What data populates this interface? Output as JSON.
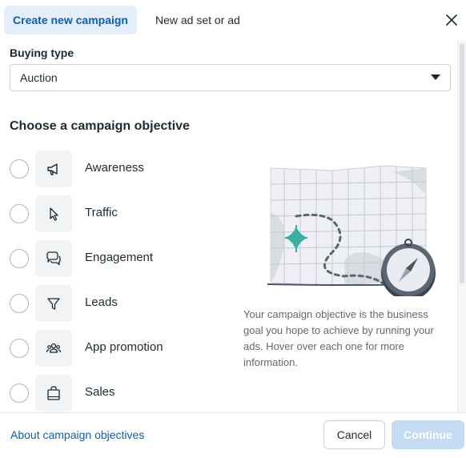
{
  "tabs": {
    "create_campaign": "Create new campaign",
    "new_ad_set": "New ad set or ad"
  },
  "buying_type": {
    "label": "Buying type",
    "value": "Auction"
  },
  "objective": {
    "heading": "Choose a campaign objective",
    "options": [
      {
        "label": "Awareness",
        "icon": "megaphone-icon"
      },
      {
        "label": "Traffic",
        "icon": "cursor-icon"
      },
      {
        "label": "Engagement",
        "icon": "chat-bubbles-icon"
      },
      {
        "label": "Leads",
        "icon": "funnel-icon"
      },
      {
        "label": "App promotion",
        "icon": "people-icon"
      },
      {
        "label": "Sales",
        "icon": "shopping-bag-icon"
      }
    ],
    "info_text": "Your campaign objective is the business goal you hope to achieve by running your ads. Hover over each one for more information."
  },
  "footer": {
    "about_link": "About campaign objectives",
    "cancel": "Cancel",
    "continue": "Continue"
  },
  "colors": {
    "accent": "#0a5fb4",
    "active_tab_bg": "#e3eef8",
    "continue_disabled_bg": "#c5dbf3",
    "illustration_star": "#3ab0a5"
  }
}
